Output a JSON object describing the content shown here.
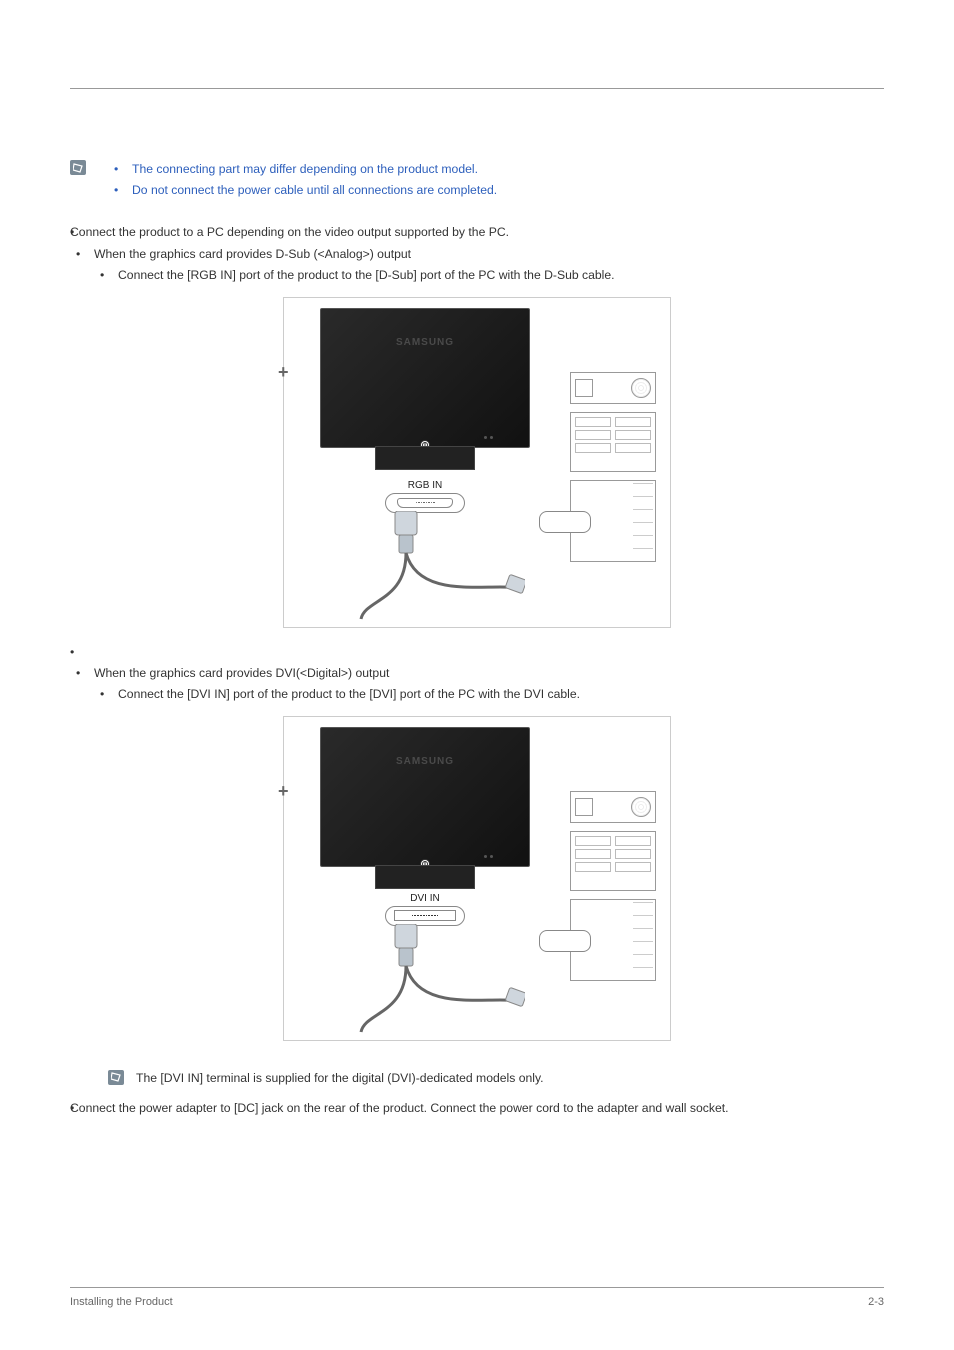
{
  "notes": {
    "top": [
      "The connecting part may differ depending on the product model.",
      "Do not connect the power cable until all connections are completed."
    ],
    "dvi_terminal": "The [DVI IN] terminal is supplied for the digital (DVI)-dedicated models only."
  },
  "body": {
    "b1": "Connect the product to a PC depending on the video output supported by the PC.",
    "b1a": "When the graphics card provides D-Sub (<Analog>) output",
    "b1a1": "Connect the [RGB IN] port of the product to the [D-Sub] port of the PC with the D-Sub cable.",
    "b1b": "When the graphics card provides DVI(<Digital>) output",
    "b1b1": "Connect the [DVI IN] port of the product to the [DVI] port of the PC with the DVI cable.",
    "b2": "Connect the power adapter to [DC] jack on the rear of the product. Connect the power cord to the adapter and wall socket."
  },
  "figure": {
    "brand": "SAMSUNG",
    "rgb_label": "RGB IN",
    "dvi_label": "DVI IN"
  },
  "footer": {
    "left": "Installing the Product",
    "right": "2-3"
  }
}
